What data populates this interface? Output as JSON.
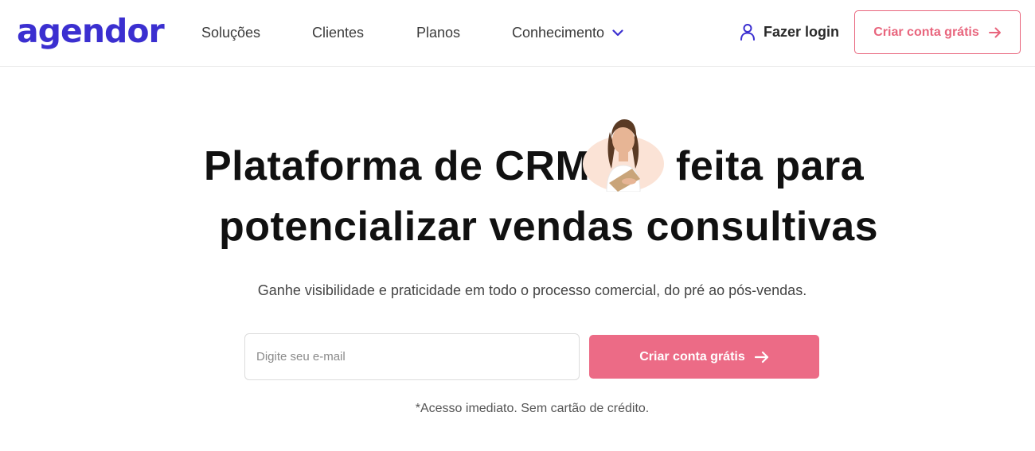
{
  "header": {
    "logo_text": "agendor",
    "nav": {
      "solucoes": "Soluções",
      "clientes": "Clientes",
      "planos": "Planos",
      "conhecimento": "Conhecimento"
    },
    "login_label": "Fazer login",
    "cta_label": "Criar conta grátis"
  },
  "hero": {
    "line1_part1": "Plataforma de CRM",
    "line1_part2": "feita para",
    "line2_highlight": "potencializar",
    "line2_rest": " vendas consultivas",
    "subtitle": "Ganhe visibilidade e praticidade em todo o processo comercial, do pré ao pós-vendas.",
    "email_placeholder": "Digite seu e-mail",
    "cta_label": "Criar conta grátis",
    "note": "*Acesso imediato. Sem cartão de crédito."
  },
  "colors": {
    "brand": "#3b2fd0",
    "accent": "#ec6b86",
    "highlight": "#54f0a4"
  },
  "icons": [
    "chevron-down-icon",
    "user-icon",
    "arrow-right-icon"
  ]
}
